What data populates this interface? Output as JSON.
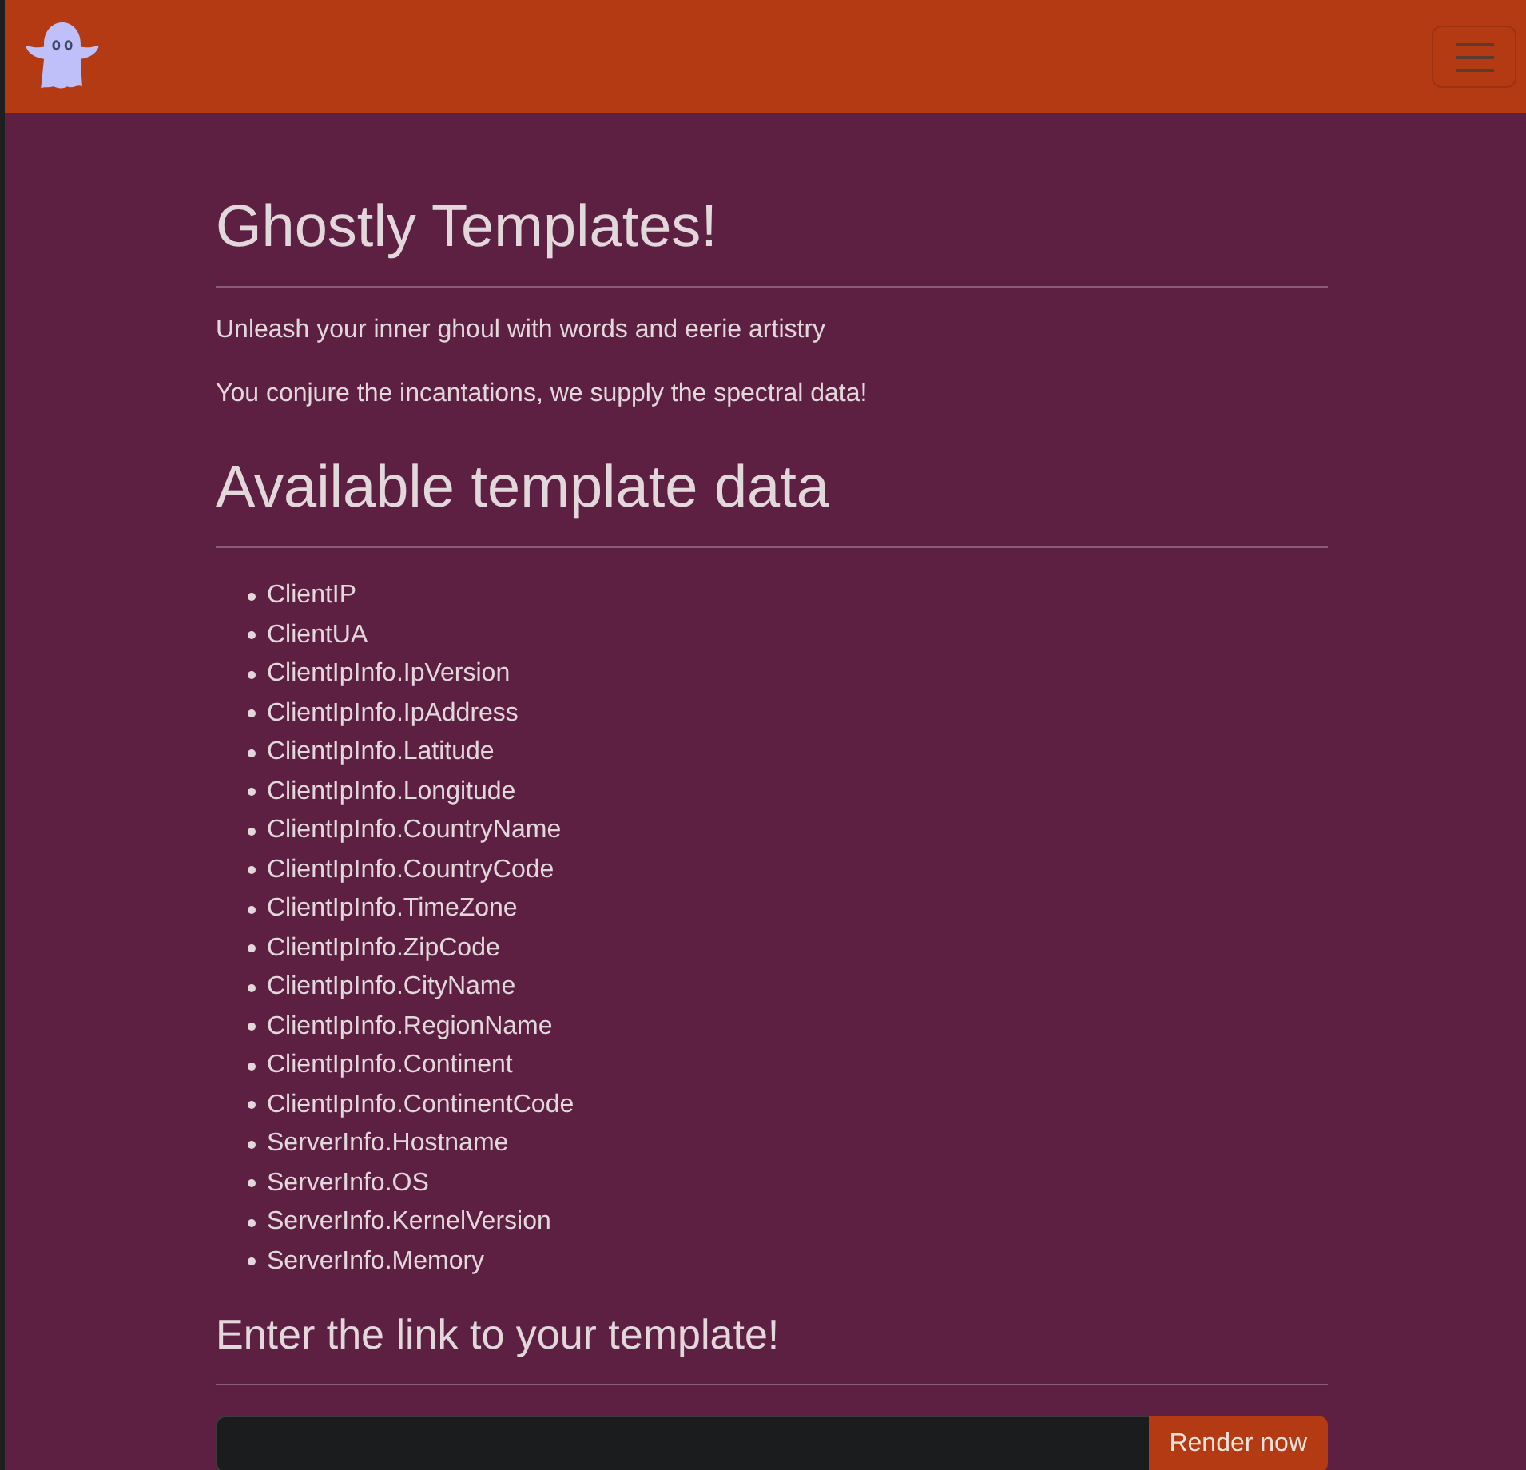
{
  "intro": {
    "title": "Ghostly Templates!",
    "lines": [
      "Unleash your inner ghoul with words and eerie artistry",
      "You conjure the incantations, we supply the spectral data!"
    ]
  },
  "template_data": {
    "heading": "Available template data",
    "items": [
      "ClientIP",
      "ClientUA",
      "ClientIpInfo.IpVersion",
      "ClientIpInfo.IpAddress",
      "ClientIpInfo.Latitude",
      "ClientIpInfo.Longitude",
      "ClientIpInfo.CountryName",
      "ClientIpInfo.CountryCode",
      "ClientIpInfo.TimeZone",
      "ClientIpInfo.ZipCode",
      "ClientIpInfo.CityName",
      "ClientIpInfo.RegionName",
      "ClientIpInfo.Continent",
      "ClientIpInfo.ContinentCode",
      "ServerInfo.Hostname",
      "ServerInfo.OS",
      "ServerInfo.KernelVersion",
      "ServerInfo.Memory"
    ]
  },
  "template_form": {
    "heading": "Enter the link to your template!",
    "button": "Render now"
  }
}
